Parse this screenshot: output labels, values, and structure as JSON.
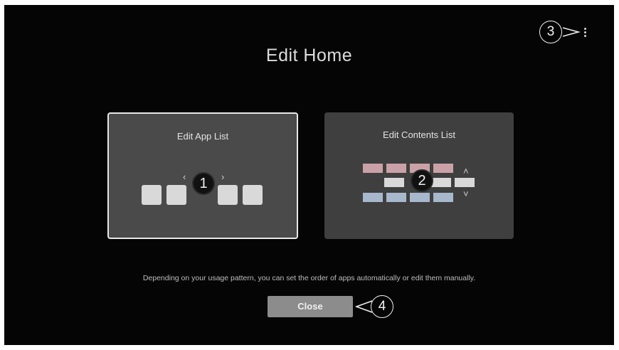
{
  "screen": {
    "title": "Edit Home",
    "menu_icon": "more-vertical-icon",
    "callouts": [
      "1",
      "2",
      "3",
      "4"
    ],
    "cards": [
      {
        "label": "Edit App List",
        "selected": true
      },
      {
        "label": "Edit Contents List",
        "selected": false
      }
    ],
    "description": "Depending on your usage pattern, you can set the order of apps automatically or edit them manually.",
    "close_label": "Close"
  },
  "colors": {
    "background": "#050505",
    "card_selected": "#4a4a4a",
    "card": "#3f3f3f",
    "close_button": "#8c8c8c",
    "pink_tile": "#c9a1a6",
    "blue_tile": "#a8b8cc"
  }
}
